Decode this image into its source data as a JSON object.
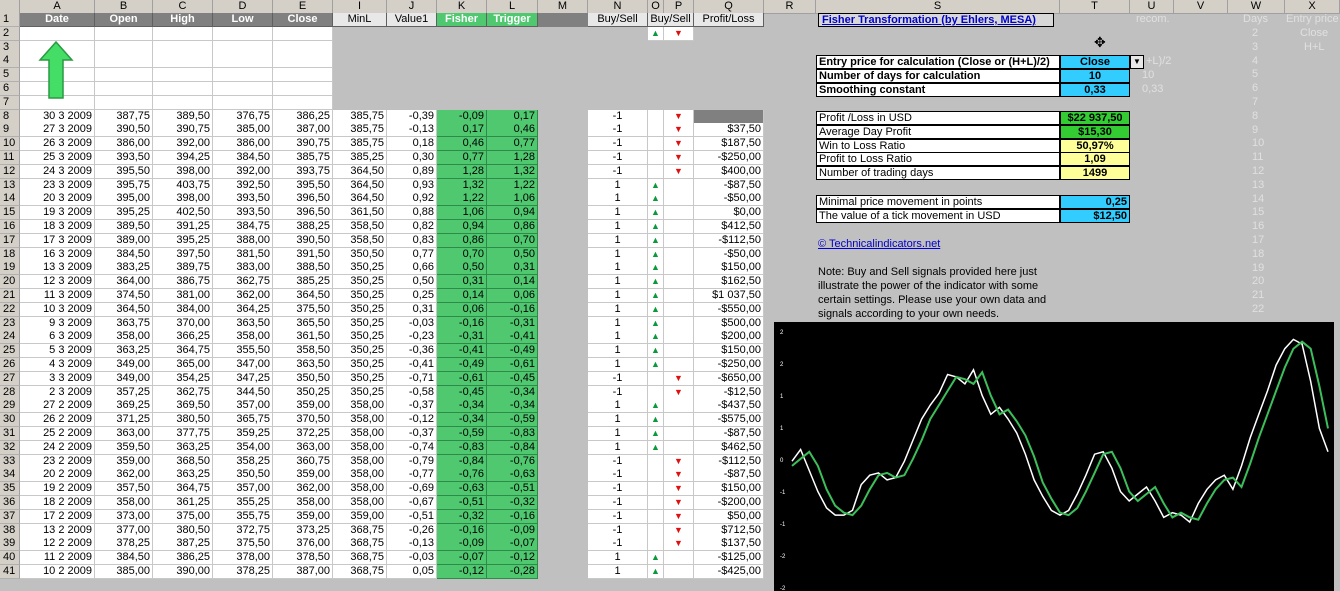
{
  "columns": [
    "A",
    "B",
    "C",
    "D",
    "E",
    "",
    "I",
    "J",
    "K",
    "L",
    "M",
    "N",
    "O",
    "P",
    "Q",
    "R",
    "S",
    "T",
    "U",
    "V",
    "W",
    "X"
  ],
  "table_headers": {
    "date": "Date",
    "open": "Open",
    "high": "High",
    "low": "Low",
    "close": "Close",
    "minl": "MinL",
    "value1": "Value1",
    "fisher": "Fisher",
    "trigger": "Trigger",
    "buysell_n": "Buy/Sell",
    "buysell_op": "Buy/Sell",
    "pl": "Profit/Loss"
  },
  "title_link": "Fisher Transformation (by Ehlers, MESA)",
  "ghost_headers": {
    "recom": "recom.",
    "days": "Days",
    "entry": "Entry price"
  },
  "ghost_entry_options": [
    "Close",
    "H+L"
  ],
  "ghost_days": [
    "2",
    "3",
    "4",
    "5",
    "6",
    "7",
    "8",
    "9",
    "10",
    "11",
    "12",
    "13",
    "14",
    "15",
    "16",
    "17",
    "18",
    "19",
    "20",
    "21",
    "22"
  ],
  "params": [
    {
      "label": "Entry price for calculation (Close or (H+L)/2)",
      "value": "Close",
      "ghost": "+L)/2"
    },
    {
      "label": "Number of days for calculation",
      "value": "10",
      "ghost": "10"
    },
    {
      "label": "Smoothing constant",
      "value": "0,33",
      "ghost": "0,33"
    }
  ],
  "stats": [
    {
      "label": "Profit /Loss in USD",
      "value": "$22 937,50",
      "tone": "green"
    },
    {
      "label": "Average Day Profit",
      "value": "$15,30",
      "tone": "green"
    },
    {
      "label": "Win to Loss Ratio",
      "value": "50,97%",
      "tone": "yellow"
    },
    {
      "label": "Profit to Loss Ratio",
      "value": "1,09",
      "tone": "yellow"
    },
    {
      "label": "Number of trading days",
      "value": "1499",
      "tone": "yellow"
    }
  ],
  "ticks": [
    {
      "label": "Minimal price movement in points",
      "value": "0,25"
    },
    {
      "label": "The value of a tick movement in USD",
      "value": "$12,50"
    }
  ],
  "site_link": "© Technicalindicators.net",
  "note": "Note: Buy and Sell signals provided here just illustrate the power of the indicator with some certain settings. Please use your own data and signals according to your own needs.",
  "rows": [
    [
      "30  3  2009",
      "387,75",
      "389,50",
      "376,75",
      "386,25",
      "385,75",
      "-0,39",
      "-0,09",
      "0,17",
      "-1",
      "dn",
      ""
    ],
    [
      "27  3  2009",
      "390,50",
      "390,75",
      "385,00",
      "387,00",
      "385,75",
      "-0,13",
      "0,17",
      "0,46",
      "-1",
      "dn",
      "$37,50"
    ],
    [
      "26  3  2009",
      "386,00",
      "392,00",
      "386,00",
      "390,75",
      "385,75",
      "0,18",
      "0,46",
      "0,77",
      "-1",
      "dn",
      "$187,50"
    ],
    [
      "25  3  2009",
      "393,50",
      "394,25",
      "384,50",
      "385,75",
      "385,25",
      "0,30",
      "0,77",
      "1,28",
      "-1",
      "dn",
      "-$250,00"
    ],
    [
      "24  3  2009",
      "395,50",
      "398,00",
      "392,00",
      "393,75",
      "364,50",
      "0,89",
      "1,28",
      "1,32",
      "-1",
      "dn",
      "$400,00"
    ],
    [
      "23  3  2009",
      "395,75",
      "403,75",
      "392,50",
      "395,50",
      "364,50",
      "0,93",
      "1,32",
      "1,22",
      "1",
      "up",
      "-$87,50"
    ],
    [
      "20  3  2009",
      "395,00",
      "398,00",
      "393,50",
      "396,50",
      "364,50",
      "0,92",
      "1,22",
      "1,06",
      "1",
      "up",
      "-$50,00"
    ],
    [
      "19  3  2009",
      "395,25",
      "402,50",
      "393,50",
      "396,50",
      "361,50",
      "0,88",
      "1,06",
      "0,94",
      "1",
      "up",
      "$0,00"
    ],
    [
      "18  3  2009",
      "389,50",
      "391,25",
      "384,75",
      "388,25",
      "358,50",
      "0,82",
      "0,94",
      "0,86",
      "1",
      "up",
      "$412,50"
    ],
    [
      "17  3  2009",
      "389,00",
      "395,25",
      "388,00",
      "390,50",
      "358,50",
      "0,83",
      "0,86",
      "0,70",
      "1",
      "up",
      "-$112,50"
    ],
    [
      "16  3  2009",
      "384,50",
      "397,50",
      "381,50",
      "391,50",
      "350,50",
      "0,77",
      "0,70",
      "0,50",
      "1",
      "up",
      "-$50,00"
    ],
    [
      "13  3  2009",
      "383,25",
      "389,75",
      "383,00",
      "388,50",
      "350,25",
      "0,66",
      "0,50",
      "0,31",
      "1",
      "up",
      "$150,00"
    ],
    [
      "12  3  2009",
      "364,00",
      "386,75",
      "362,75",
      "385,25",
      "350,25",
      "0,50",
      "0,31",
      "0,14",
      "1",
      "up",
      "$162,50"
    ],
    [
      "11  3  2009",
      "374,50",
      "381,00",
      "362,00",
      "364,50",
      "350,25",
      "0,25",
      "0,14",
      "0,06",
      "1",
      "up",
      "$1 037,50"
    ],
    [
      "10  3  2009",
      "364,50",
      "384,00",
      "364,25",
      "375,50",
      "350,25",
      "0,31",
      "0,06",
      "-0,16",
      "1",
      "up",
      "-$550,00"
    ],
    [
      "9  3  2009",
      "363,75",
      "370,00",
      "363,50",
      "365,50",
      "350,25",
      "-0,03",
      "-0,16",
      "-0,31",
      "1",
      "up",
      "$500,00"
    ],
    [
      "6  3  2009",
      "358,00",
      "366,25",
      "358,00",
      "361,50",
      "350,25",
      "-0,23",
      "-0,31",
      "-0,41",
      "1",
      "up",
      "$200,00"
    ],
    [
      "5  3  2009",
      "363,25",
      "364,75",
      "355,50",
      "358,50",
      "350,25",
      "-0,36",
      "-0,41",
      "-0,49",
      "1",
      "up",
      "$150,00"
    ],
    [
      "4  3  2009",
      "349,00",
      "365,00",
      "347,00",
      "363,50",
      "350,25",
      "-0,41",
      "-0,49",
      "-0,61",
      "1",
      "up",
      "-$250,00"
    ],
    [
      "3  3  2009",
      "349,00",
      "354,25",
      "347,25",
      "350,50",
      "350,25",
      "-0,71",
      "-0,61",
      "-0,45",
      "-1",
      "dn",
      "-$650,00"
    ],
    [
      "2  3  2009",
      "357,25",
      "362,75",
      "344,50",
      "350,25",
      "350,25",
      "-0,58",
      "-0,45",
      "-0,34",
      "-1",
      "dn",
      "-$12,50"
    ],
    [
      "27  2  2009",
      "369,25",
      "369,50",
      "357,00",
      "359,00",
      "358,00",
      "-0,37",
      "-0,34",
      "-0,34",
      "1",
      "up",
      "-$437,50"
    ],
    [
      "26  2  2009",
      "371,25",
      "380,50",
      "365,75",
      "370,50",
      "358,00",
      "-0,12",
      "-0,34",
      "-0,59",
      "1",
      "up",
      "-$575,00"
    ],
    [
      "25  2  2009",
      "363,00",
      "377,75",
      "359,25",
      "372,25",
      "358,00",
      "-0,37",
      "-0,59",
      "-0,83",
      "1",
      "up",
      "-$87,50"
    ],
    [
      "24  2  2009",
      "359,50",
      "363,25",
      "354,00",
      "363,00",
      "358,00",
      "-0,74",
      "-0,83",
      "-0,84",
      "1",
      "up",
      "$462,50"
    ],
    [
      "23  2  2009",
      "359,00",
      "368,50",
      "358,25",
      "360,75",
      "358,00",
      "-0,79",
      "-0,84",
      "-0,76",
      "-1",
      "dn",
      "-$112,50"
    ],
    [
      "20  2  2009",
      "362,00",
      "363,25",
      "350,50",
      "359,00",
      "358,00",
      "-0,77",
      "-0,76",
      "-0,63",
      "-1",
      "dn",
      "-$87,50"
    ],
    [
      "19  2  2009",
      "357,50",
      "364,75",
      "357,00",
      "362,00",
      "358,00",
      "-0,69",
      "-0,63",
      "-0,51",
      "-1",
      "dn",
      "$150,00"
    ],
    [
      "18  2  2009",
      "358,00",
      "361,25",
      "355,25",
      "358,00",
      "358,00",
      "-0,67",
      "-0,51",
      "-0,32",
      "-1",
      "dn",
      "-$200,00"
    ],
    [
      "17  2  2009",
      "373,00",
      "375,00",
      "355,75",
      "359,00",
      "359,00",
      "-0,51",
      "-0,32",
      "-0,16",
      "-1",
      "dn",
      "$50,00"
    ],
    [
      "13  2  2009",
      "377,00",
      "380,50",
      "372,75",
      "373,25",
      "368,75",
      "-0,26",
      "-0,16",
      "-0,09",
      "-1",
      "dn",
      "$712,50"
    ],
    [
      "12  2  2009",
      "378,25",
      "387,25",
      "375,50",
      "376,00",
      "368,75",
      "-0,13",
      "-0,09",
      "-0,07",
      "-1",
      "dn",
      "$137,50"
    ],
    [
      "11  2  2009",
      "384,50",
      "386,25",
      "378,00",
      "378,50",
      "368,75",
      "-0,03",
      "-0,07",
      "-0,12",
      "1",
      "up",
      "-$125,00"
    ],
    [
      "10  2  2009",
      "385,00",
      "390,00",
      "378,25",
      "387,00",
      "368,75",
      "0,05",
      "-0,12",
      "-0,28",
      "1",
      "up",
      "-$425,00"
    ]
  ],
  "chart_data": {
    "type": "line",
    "series": [
      {
        "values": [
          0.1,
          0.35,
          -0.1,
          -0.55,
          -0.9,
          -1.05,
          -1.05,
          -0.95,
          -0.4,
          -0.2,
          -0.15,
          -0.3,
          -0.25,
          0.1,
          0.55,
          1.0,
          1.3,
          1.55,
          1.95,
          1.9,
          1.75,
          2.05,
          1.5,
          1.1,
          1.25,
          1.0,
          0.7,
          0.25,
          -0.3,
          -0.65,
          -0.95,
          -1.05,
          -0.95,
          -0.6,
          -0.2,
          0.25,
          0.3,
          -0.05,
          -0.55,
          -0.75,
          -0.6,
          -0.45,
          -0.75,
          -1.1,
          -1.0,
          -1.05,
          -1.2,
          -0.8,
          -0.5,
          -0.3,
          -0.2,
          -0.5,
          0.0,
          0.6,
          1.1,
          1.6,
          2.15,
          2.5,
          2.7,
          2.6,
          1.8,
          0.8,
          0.3
        ]
      },
      {
        "values": [
          0.0,
          0.15,
          0.3,
          0.0,
          -0.5,
          -0.85,
          -1.0,
          -1.05,
          -0.85,
          -0.5,
          -0.2,
          -0.15,
          -0.25,
          -0.2,
          0.15,
          0.55,
          1.0,
          1.3,
          1.6,
          1.9,
          1.85,
          1.75,
          2.0,
          1.5,
          1.1,
          1.2,
          0.95,
          0.65,
          0.2,
          -0.35,
          -0.7,
          -1.0,
          -1.05,
          -0.9,
          -0.55,
          -0.15,
          0.25,
          0.3,
          -0.05,
          -0.55,
          -0.75,
          -0.6,
          -0.45,
          -0.8,
          -1.1,
          -1.0,
          -1.1,
          -1.15,
          -0.8,
          -0.5,
          -0.3,
          -0.25,
          -0.45,
          0.05,
          0.6,
          1.1,
          1.6,
          2.1,
          2.5,
          2.65,
          2.5,
          1.7,
          0.8
        ]
      }
    ],
    "y_tick_labels": [
      "2",
      "2",
      "1",
      "1",
      "0",
      "-1",
      "-1",
      "-2",
      "-2"
    ]
  }
}
